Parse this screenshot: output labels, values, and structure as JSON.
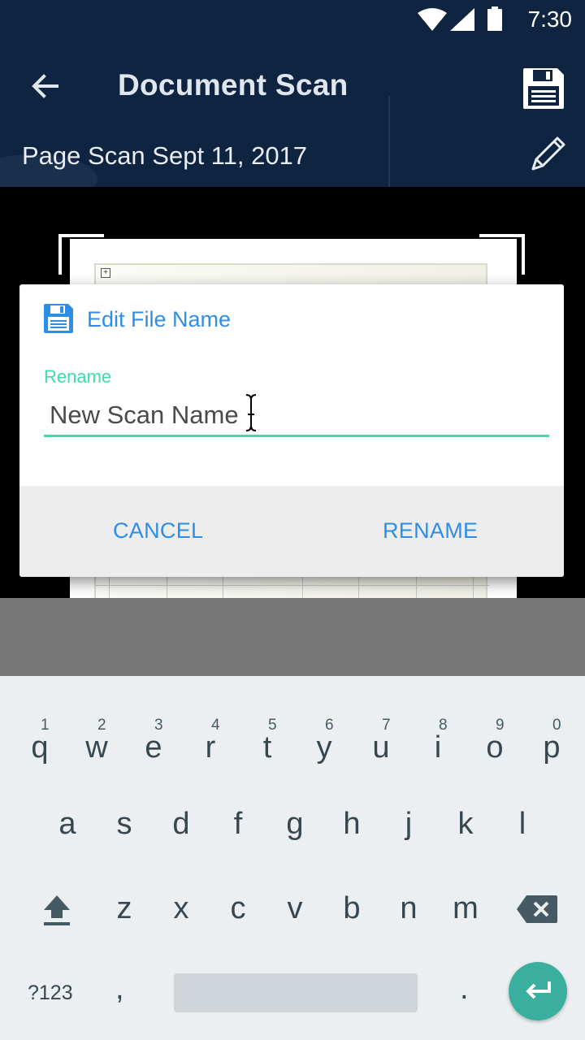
{
  "status_bar": {
    "time": "7:30",
    "icons": [
      "wifi-icon",
      "signal-icon",
      "battery-icon"
    ]
  },
  "app_bar": {
    "title": "Document Scan",
    "subtitle": "Page Scan Sept 11, 2017",
    "icons": [
      "back-arrow-icon",
      "save-icon",
      "edit-pencil-icon"
    ]
  },
  "dialog": {
    "title": "Edit File Name",
    "icon": "save-icon",
    "field_label": "Rename",
    "field_value": "New Scan Name",
    "cancel_label": "CANCEL",
    "rename_label": "RENAME"
  },
  "keyboard": {
    "row1": [
      {
        "ch": "q",
        "hint": "1"
      },
      {
        "ch": "w",
        "hint": "2"
      },
      {
        "ch": "e",
        "hint": "3"
      },
      {
        "ch": "r",
        "hint": "4"
      },
      {
        "ch": "t",
        "hint": "5"
      },
      {
        "ch": "y",
        "hint": "6"
      },
      {
        "ch": "u",
        "hint": "7"
      },
      {
        "ch": "i",
        "hint": "8"
      },
      {
        "ch": "o",
        "hint": "9"
      },
      {
        "ch": "p",
        "hint": "0"
      }
    ],
    "row2": [
      "a",
      "s",
      "d",
      "f",
      "g",
      "h",
      "j",
      "k",
      "l"
    ],
    "row3": [
      "z",
      "x",
      "c",
      "v",
      "b",
      "n",
      "m"
    ],
    "symbols_label": "?123",
    "comma": ",",
    "period": ".",
    "icons": [
      "shift-icon",
      "backspace-icon",
      "enter-icon"
    ]
  },
  "colors": {
    "app_bar": "#0f2440",
    "accent_blue": "#2e8de6",
    "accent_teal": "#3ddcaa",
    "enter_key": "#3aaf9f"
  }
}
